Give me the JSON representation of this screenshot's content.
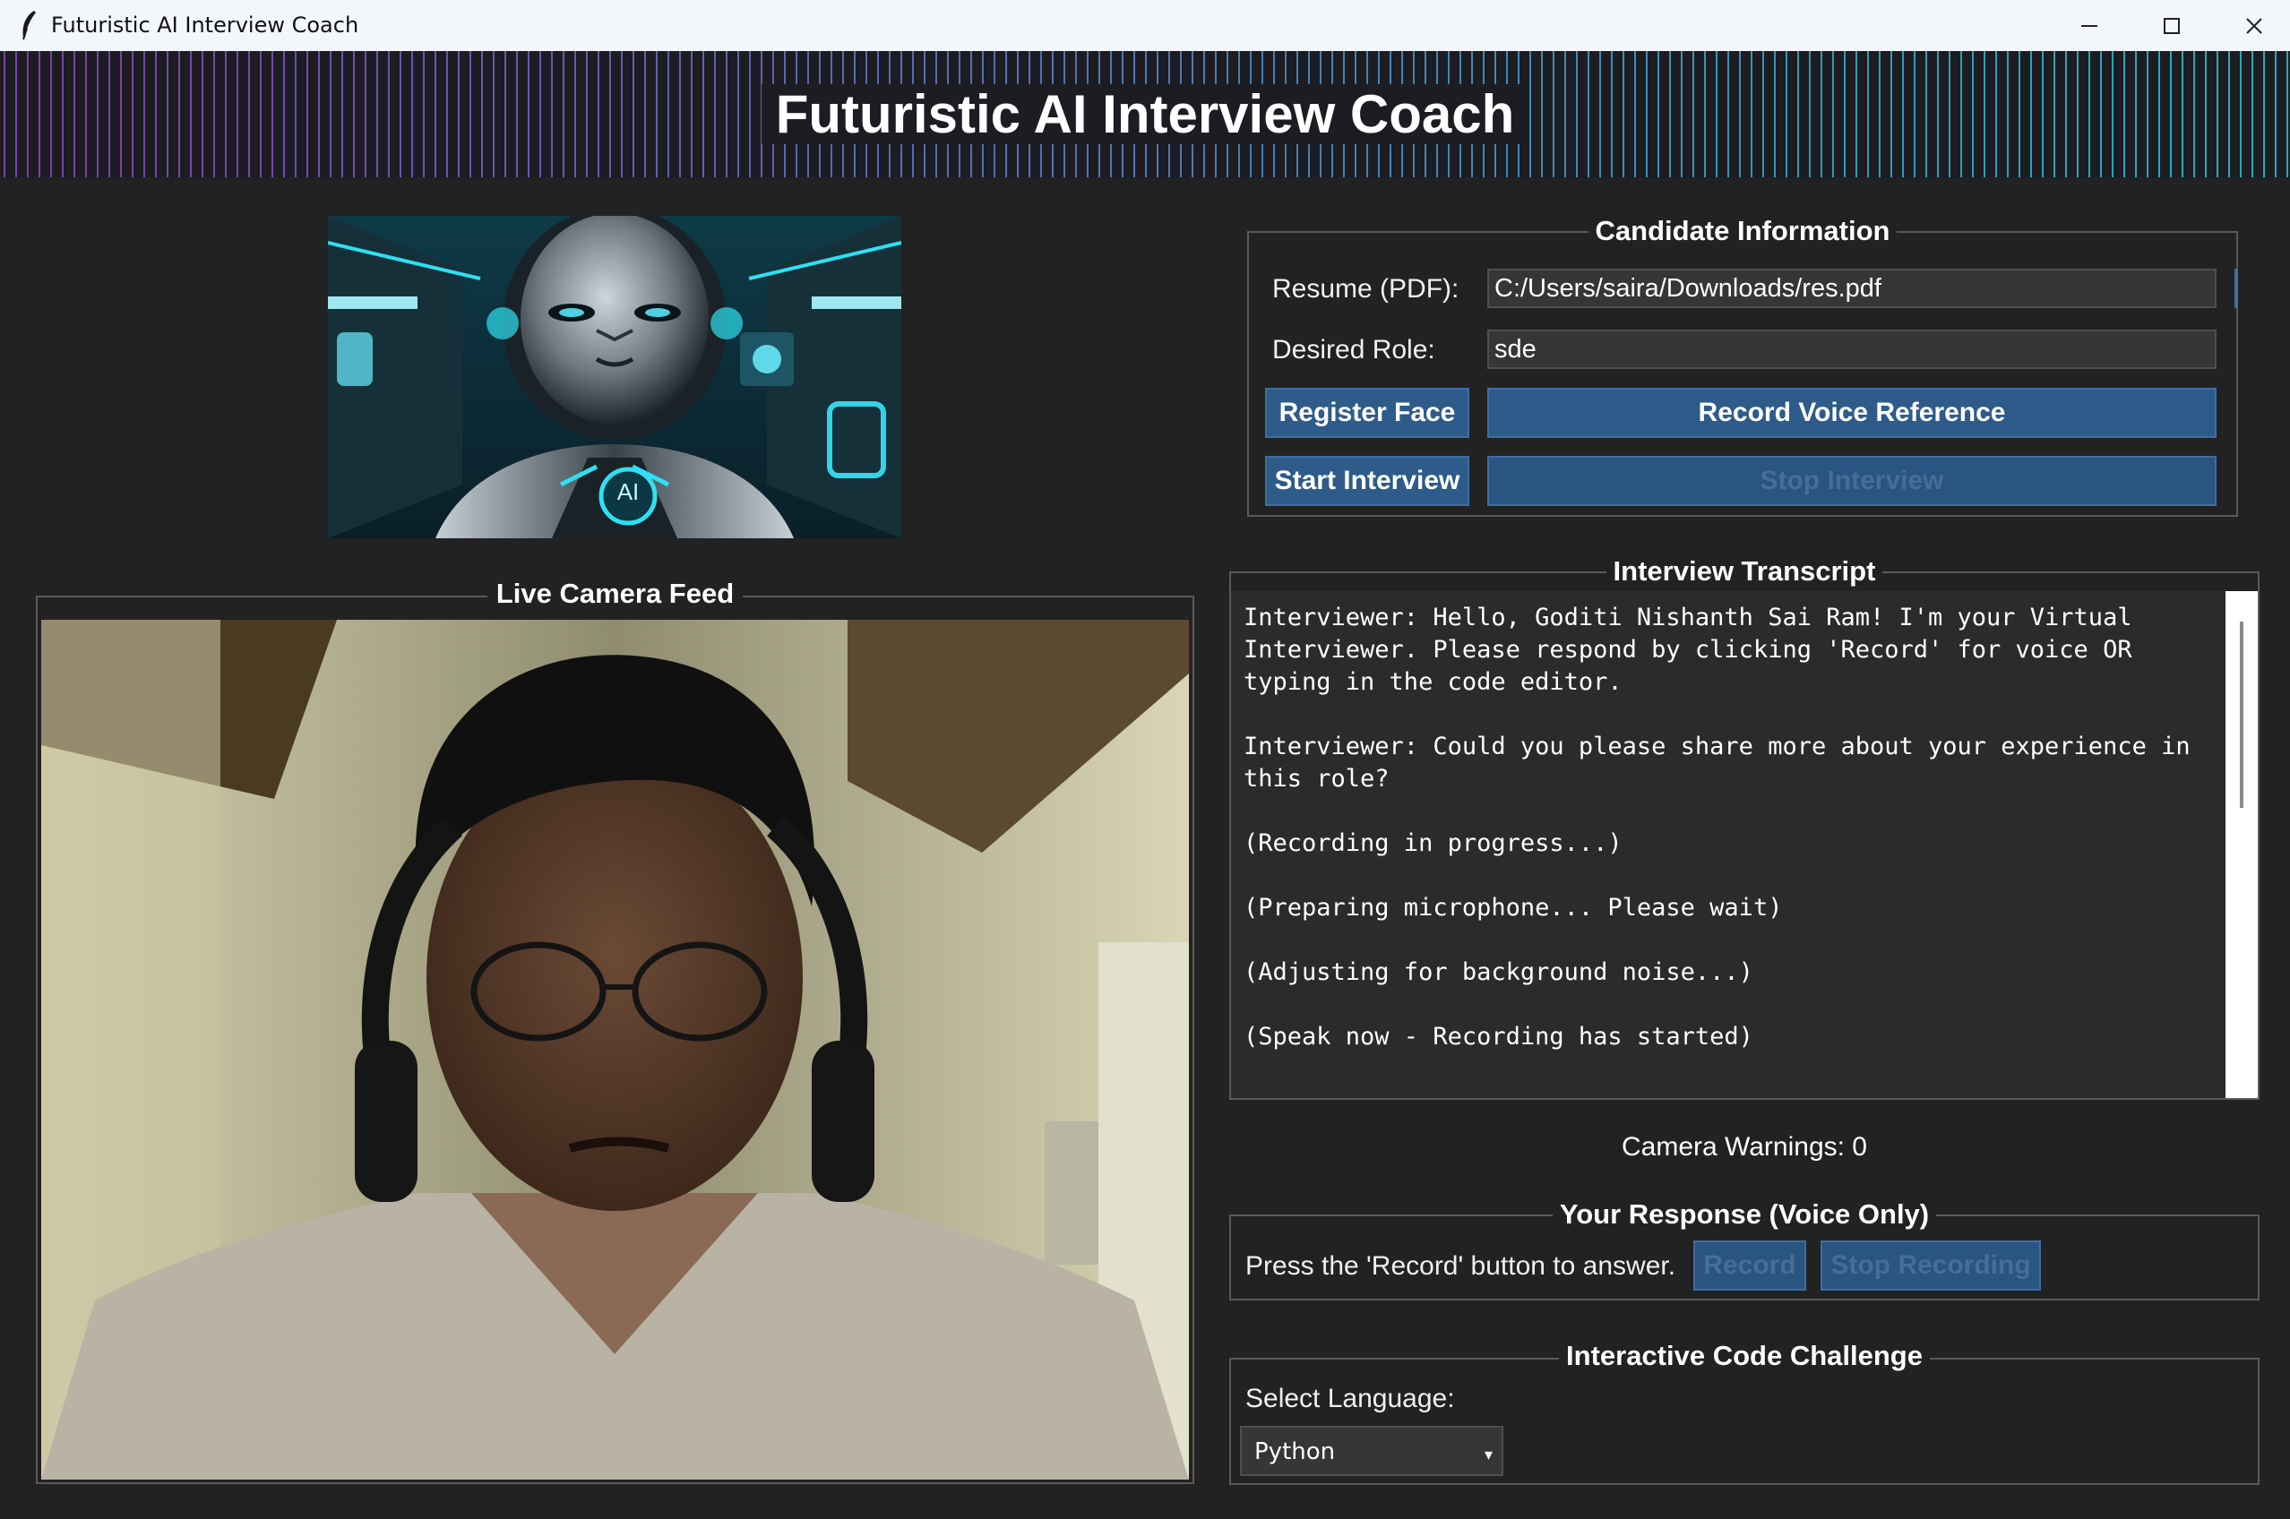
{
  "window": {
    "title": "Futuristic AI Interview Coach",
    "icon": "feather-icon",
    "controls": [
      "minimize-icon",
      "maximize-icon",
      "close-icon"
    ]
  },
  "header": {
    "title": "Futuristic AI Interview Coach"
  },
  "avatar": {
    "badge": "AI"
  },
  "camera": {
    "label": "Live Camera Feed"
  },
  "candidate": {
    "title": "Candidate Information",
    "resume_label": "Resume (PDF):",
    "resume_value": "C:/Users/saira/Downloads/res.pdf",
    "role_label": "Desired Role:",
    "role_value": "sde",
    "register_face": "Register Face",
    "record_voice_reference": "Record Voice Reference",
    "start_interview": "Start Interview",
    "stop_interview": "Stop Interview"
  },
  "transcript": {
    "title": "Interview Transcript",
    "lines": [
      "Interviewer: Hello, Goditi Nishanth Sai Ram! I'm your Virtual",
      "Interviewer. Please respond by clicking 'Record' for voice OR",
      "typing in the code editor.",
      "",
      "Interviewer: Could you please share more about your experience in",
      "this role?",
      "",
      "(Recording in progress...)",
      "",
      "(Preparing microphone... Please wait)",
      "",
      "(Adjusting for background noise...)",
      "",
      "(Speak now - Recording has started)"
    ]
  },
  "camera_warnings": "Camera Warnings: 0",
  "response": {
    "title": "Your Response (Voice Only)",
    "prompt": "Press the 'Record' button to answer.",
    "record": "Record",
    "stop_recording": "Stop Recording"
  },
  "code_challenge": {
    "title": "Interactive Code Challenge",
    "select_label": "Select Language:",
    "language": "Python"
  },
  "colors": {
    "background": "#222222",
    "button": "#2e5b8a",
    "stripe_purple": "#7b3fa8",
    "stripe_teal": "#1fb0b8"
  }
}
